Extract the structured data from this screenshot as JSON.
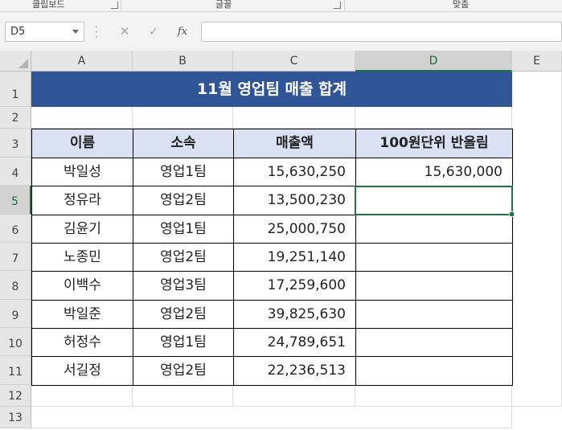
{
  "ribbon": {
    "groups": [
      {
        "label": "클립보드"
      },
      {
        "label": "글꼴"
      },
      {
        "label": "맞춤"
      }
    ]
  },
  "formula_bar": {
    "name_box": "D5",
    "cancel_icon": "✕",
    "enter_icon": "✓",
    "fx_label": "fx",
    "formula": ""
  },
  "sheet": {
    "columns": [
      "A",
      "B",
      "C",
      "D",
      "E"
    ],
    "selected_column": "D",
    "rows": [
      "1",
      "2",
      "3",
      "4",
      "5",
      "6",
      "7",
      "8",
      "9",
      "10",
      "11",
      "12",
      "13"
    ],
    "selected_row": "5",
    "title": "11월 영업팀 매출 합계",
    "headers": [
      "이름",
      "소속",
      "매출액",
      "100원단위 반올림"
    ],
    "data": [
      {
        "name": "박일성",
        "team": "영업1팀",
        "sales": "15,630,250",
        "rounded": "15,630,000"
      },
      {
        "name": "정유라",
        "team": "영업2팀",
        "sales": "13,500,230",
        "rounded": ""
      },
      {
        "name": "김윤기",
        "team": "영업1팀",
        "sales": "25,000,750",
        "rounded": ""
      },
      {
        "name": "노종민",
        "team": "영업2팀",
        "sales": "19,251,140",
        "rounded": ""
      },
      {
        "name": "이백수",
        "team": "영업3팀",
        "sales": "17,259,600",
        "rounded": ""
      },
      {
        "name": "박일준",
        "team": "영업2팀",
        "sales": "39,825,630",
        "rounded": ""
      },
      {
        "name": "허정수",
        "team": "영업1팀",
        "sales": "24,789,651",
        "rounded": ""
      },
      {
        "name": "서길정",
        "team": "영업2팀",
        "sales": "22,236,513",
        "rounded": ""
      }
    ]
  },
  "colors": {
    "title_bg": "#2f5597",
    "header_bg": "#d9e1f2",
    "selection": "#217346"
  }
}
